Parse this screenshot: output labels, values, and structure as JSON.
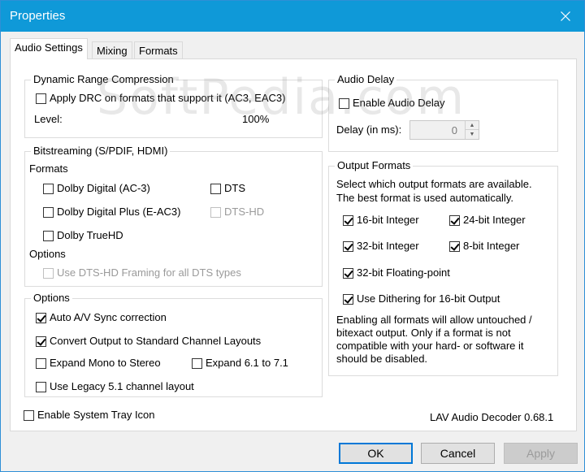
{
  "window": {
    "title": "Properties"
  },
  "tabs": [
    {
      "label": "Audio Settings",
      "active": true
    },
    {
      "label": "Mixing",
      "active": false
    },
    {
      "label": "Formats",
      "active": false
    }
  ],
  "drc": {
    "title": "Dynamic Range Compression",
    "apply_label": "Apply DRC on formats that support it (AC3, EAC3)",
    "apply_checked": false,
    "level_label": "Level:",
    "level_value": "100%"
  },
  "bitstreaming": {
    "title": "Bitstreaming (S/PDIF, HDMI)",
    "formats_label": "Formats",
    "dolby_digital": "Dolby Digital (AC-3)",
    "dts": "DTS",
    "dolby_digital_plus": "Dolby Digital Plus (E-AC3)",
    "dts_hd": "DTS-HD",
    "dolby_truehd": "Dolby TrueHD",
    "options_label": "Options",
    "dtshd_framing": "Use DTS-HD Framing for all DTS types"
  },
  "options": {
    "title": "Options",
    "auto_av_sync": "Auto A/V Sync correction",
    "convert_output": "Convert Output to Standard Channel Layouts",
    "expand_mono": "Expand Mono to Stereo",
    "expand_61": "Expand 6.1 to 7.1",
    "legacy_51": "Use Legacy 5.1 channel layout"
  },
  "audio_delay": {
    "title": "Audio Delay",
    "enable_label": "Enable Audio Delay",
    "delay_label": "Delay (in ms):",
    "delay_value": "0"
  },
  "output_formats": {
    "title": "Output Formats",
    "desc_line1": "Select which output formats are available.",
    "desc_line2": "The best format is used automatically.",
    "int16": "16-bit Integer",
    "int24": "24-bit Integer",
    "int32": "32-bit Integer",
    "int8": "8-bit Integer",
    "float32": "32-bit Floating-point",
    "dithering": "Use Dithering for 16-bit Output",
    "note_line1": "Enabling all formats will allow untouched /",
    "note_line2": "bitexact output. Only if a format is not",
    "note_line3": "compatible with your hard- or software it",
    "note_line4": "should be disabled."
  },
  "footer": {
    "tray_icon_label": "Enable System Tray Icon",
    "version": "LAV Audio Decoder 0.68.1"
  },
  "buttons": {
    "ok": "OK",
    "cancel": "Cancel",
    "apply": "Apply"
  },
  "watermark": "SoftPedia.com",
  "colors": {
    "titlebar": "#0f99d8",
    "accent": "#0078d7"
  }
}
